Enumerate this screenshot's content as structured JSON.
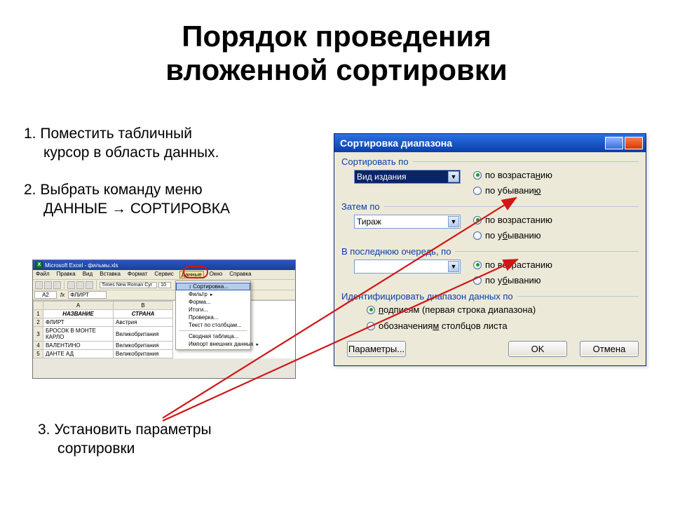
{
  "title_line1": "Порядок проведения",
  "title_line2": "вложенной сортировки",
  "steps": {
    "s1a": "1. Поместить табличный",
    "s1b": "курсор в область данных.",
    "s2a": "2. Выбрать команду меню",
    "s2b": "ДАННЫЕ → СОРТИРОВКА",
    "s3a": "3. Установить параметры",
    "s3b": "сортировки"
  },
  "excel": {
    "title": "Microsoft Excel - фильмы.xls",
    "menu": [
      "Файл",
      "Правка",
      "Вид",
      "Вставка",
      "Формат",
      "Сервис",
      "Данные",
      "Окно",
      "Справка"
    ],
    "font": "Times New Roman Cyr",
    "fontsize": "10",
    "cellname": "A2",
    "cellval": "ФЛИРТ",
    "headers": [
      "",
      "A",
      "B"
    ],
    "rows": [
      [
        "1",
        "НАЗВАНИЕ",
        "СТРАНА"
      ],
      [
        "2",
        "ФЛИРТ",
        "Австрия"
      ],
      [
        "3",
        "БРОСОК В МОНТЕ КАРЛО",
        "Великобритания"
      ],
      [
        "4",
        "ВАЛЕНТИНО",
        "Великобритания"
      ],
      [
        "5",
        "ДАНТЕ АД",
        "Великобритания"
      ]
    ],
    "dropdown": [
      {
        "t": "Сортировка...",
        "hi": true
      },
      {
        "t": "Фильтр",
        "arr": true
      },
      {
        "t": "Форма..."
      },
      {
        "t": "Итоги..."
      },
      {
        "t": "Проверка..."
      },
      {
        "t": "Текст по столбцам...",
        "div": true
      },
      {
        "t": "Сводная таблица..."
      },
      {
        "t": "Импорт внешних данных",
        "arr": true
      }
    ]
  },
  "dialog": {
    "title": "Сортировка диапазона",
    "g1": "Сортировать по",
    "g1_combo": "Вид издания",
    "g2": "Затем по",
    "g2_combo": "Тираж",
    "g3": "В последнюю очередь, по",
    "g3_combo": "",
    "asc_a": "по возраста",
    "asc_b": "н",
    "asc_c": "ию",
    "desc_a": "по убывани",
    "desc_b": "ю",
    "asc2": "по возрастанию",
    "desc2_a": "по у",
    "desc2_b": "б",
    "desc2_c": "ыванию",
    "ident": "Идентифицировать диапазон данных по",
    "ident1_a": "п",
    "ident1_b": "одписям (первая строка диапазона)",
    "ident2_a": "обозначения",
    "ident2_b": "м",
    "ident2_c": " столбцов листа",
    "params": "Параметры...",
    "ok": "OK",
    "cancel": "Отмена"
  }
}
